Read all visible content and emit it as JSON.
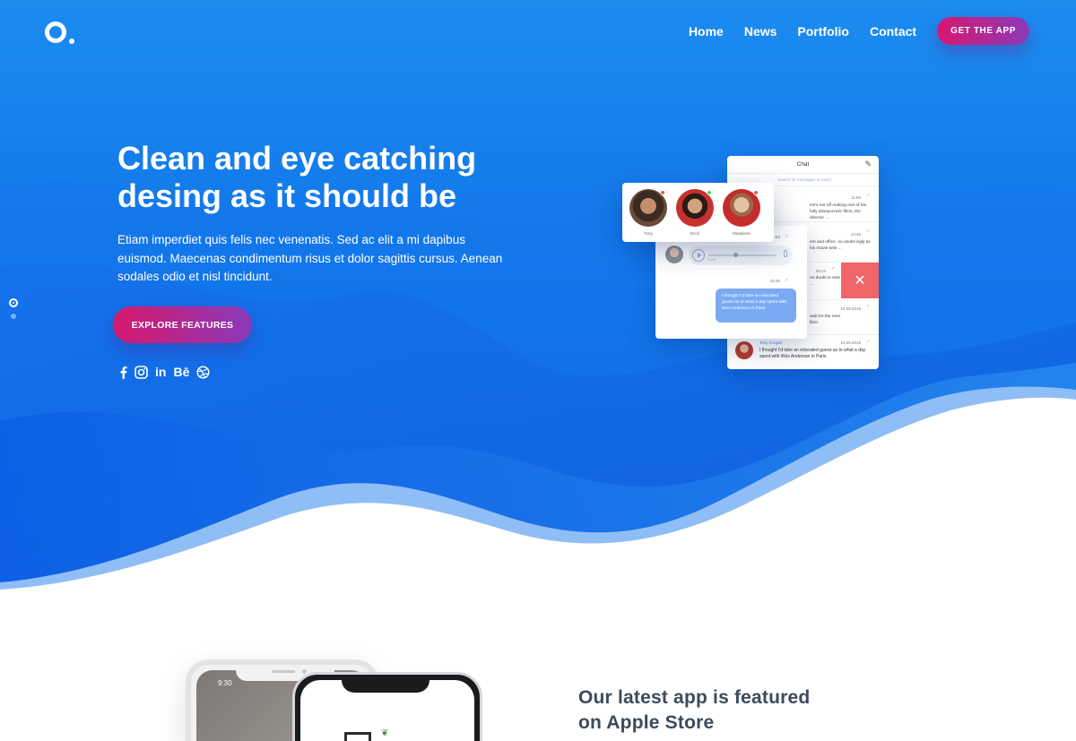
{
  "nav": {
    "items": [
      "Home",
      "News",
      "Portfolio",
      "Contact"
    ],
    "cta": "GET THE APP"
  },
  "hero": {
    "title_line1": "Clean and eye catching",
    "title_line2": "desing as it should be",
    "description": "Etiam imperdiet quis felis nec venenatis. Sed ac elit a mi dapibus euismod. Maecenas condimentum risus et dolor sagittis cursus. Aenean sodales odio et nisl tincidunt.",
    "button": "EXPLORE FEATURES",
    "socials": [
      "facebook-icon",
      "instagram-icon",
      "linkedin-icon",
      "behance-icon",
      "dribbble-icon"
    ],
    "behance_text": "Bē",
    "linkedin_text": "in",
    "facebook_text": "f"
  },
  "chat": {
    "title": "Chat",
    "search_placeholder": "Search for messages or users",
    "rows": [
      {
        "time": "11:53",
        "text": "He's not off making one of his fully idiosyncratic films, the director ..."
      },
      {
        "time": "10:46",
        "text": "ent and office, no doubt ingly as his movie sets ..."
      },
      {
        "time": "09:24",
        "text": "no doubt ie sets ..."
      },
      {
        "time": "15.09.2016",
        "text": "wait for the next film!"
      }
    ],
    "last_message": {
      "name": "Tony Cooper",
      "time": "13.09.2016",
      "text": "I thought I'd take an educated guess as to what a day spent with Wes Anderson in Paris"
    },
    "voice": {
      "time1": "11:53",
      "duration": "01:06",
      "time2": "10:46",
      "bubble": "I thought I'd take an educated guess as to what a day spent with Wes Anderson in Paris"
    },
    "contacts": [
      {
        "name": "Tony",
        "status": "#f35555"
      },
      {
        "name": "Erick",
        "status": "#4cd964"
      },
      {
        "name": "Madalene",
        "status": "#f35555"
      }
    ]
  },
  "phone": {
    "time": "9:30"
  },
  "featured": {
    "line1": "Our latest app is featured",
    "line2": "on Apple Store"
  },
  "colors": {
    "hero_blue": "#1a86ee",
    "deep_blue": "#0f5fe0",
    "cta_start": "#d6186e",
    "cta_end": "#8a3ab9",
    "heading_dark": "#3d4a5c"
  }
}
